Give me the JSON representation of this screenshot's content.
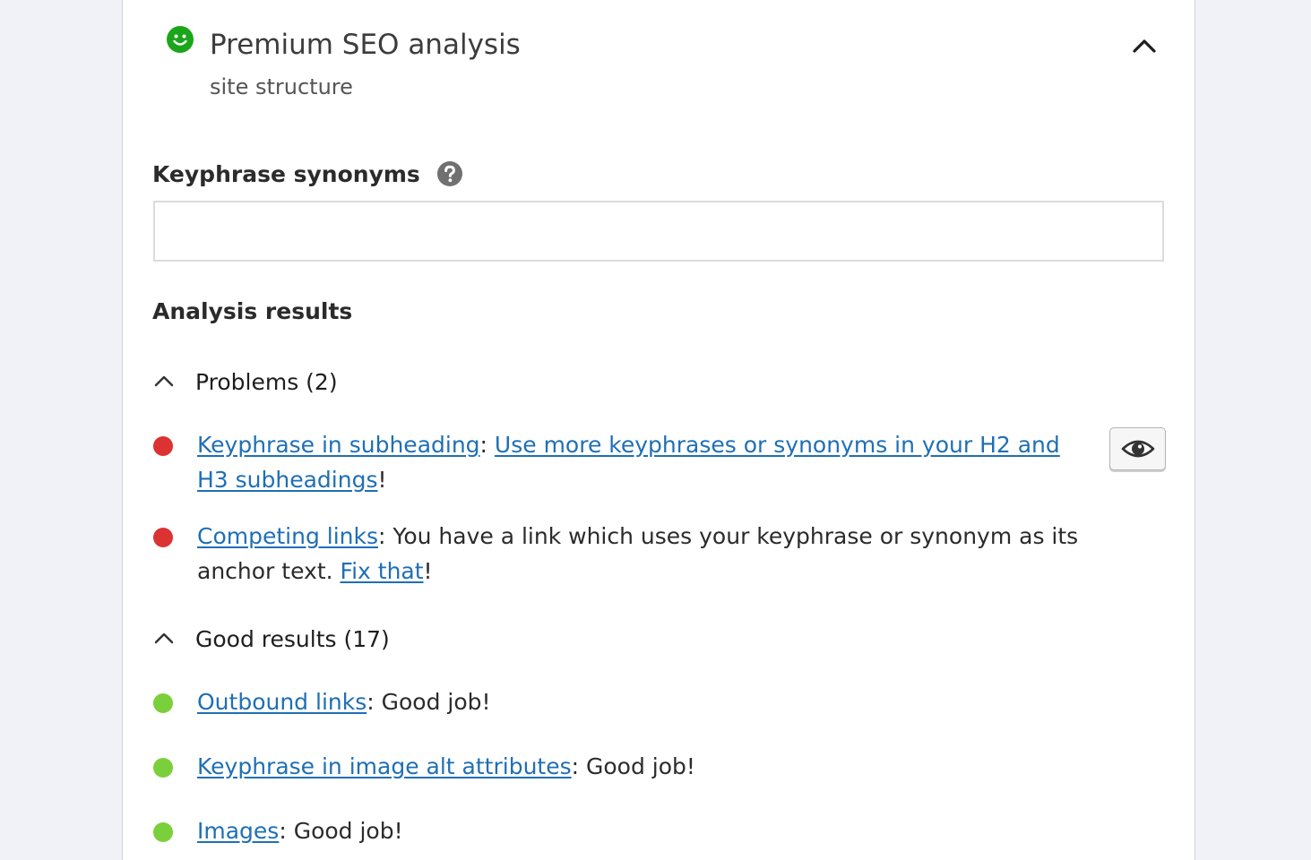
{
  "header": {
    "title": "Premium SEO analysis",
    "subtitle": "site structure",
    "status_icon": "smiley-face-icon",
    "status_color": "#1aa51a",
    "collapse_icon": "chevron-up-icon"
  },
  "synonyms": {
    "label": "Keyphrase synonyms",
    "help_icon": "question-mark-icon",
    "value": "",
    "placeholder": ""
  },
  "analysis": {
    "title": "Analysis results",
    "colors": {
      "problem": "#dc3232",
      "good": "#7ad03a",
      "link": "#1f6fb5"
    },
    "problems": {
      "label": "Problems (2)",
      "items": [
        {
          "link": "Keyphrase in subheading",
          "sep": ": ",
          "link2": "Use more keyphrases or synonyms in your H2 and H3 subheadings",
          "tail": "!"
        },
        {
          "link": "Competing links",
          "text": ": You have a link which uses your keyphrase or synonym as its anchor text. ",
          "link2": "Fix that",
          "tail": "!"
        }
      ]
    },
    "good": {
      "label": "Good results (17)",
      "items": [
        {
          "link": "Outbound links",
          "text": ": Good job!"
        },
        {
          "link": "Keyphrase in image alt attributes",
          "text": ": Good job!"
        },
        {
          "link": "Images",
          "text": ": Good job!"
        }
      ]
    },
    "eye_button_icon": "eye-icon"
  }
}
